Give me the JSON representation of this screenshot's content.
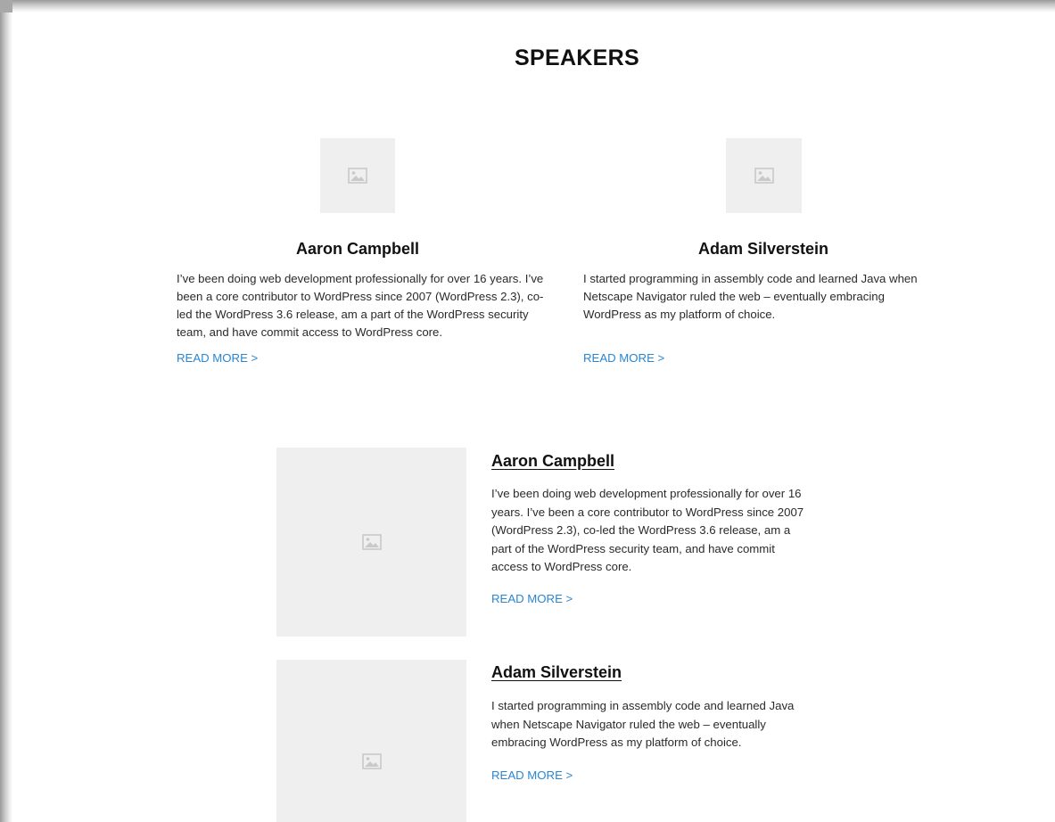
{
  "page": {
    "title": "SPEAKERS"
  },
  "grid": [
    {
      "name": "Aaron Campbell",
      "bio": "I’ve been doing web development professionally for over 16 years. I’ve been a core contributor to WordPress since 2007 (WordPress 2.3), co-led the WordPress 3.6 release, am a part of the WordPress security team, and have commit access to WordPress core.",
      "read_more": "READ MORE >"
    },
    {
      "name": "Adam Silverstein",
      "bio": "I started programming in assembly code and learned Java when Netscape Navigator ruled the web – eventually embracing WordPress as my platform of choice.",
      "read_more": "READ MORE >"
    }
  ],
  "list": [
    {
      "name": "Aaron Campbell",
      "bio": "I’ve been doing web development professionally for over 16 years. I’ve been a core contributor to WordPress since 2007 (WordPress 2.3), co-led the WordPress 3.6 release, am a part of the WordPress security team, and have commit access to WordPress core.",
      "read_more": "READ MORE >"
    },
    {
      "name": "Adam Silverstein",
      "bio": "I started programming in assembly code and learned Java when Netscape Navigator ruled the web – eventually embracing WordPress as my platform of choice.",
      "read_more": "READ MORE >"
    }
  ],
  "icons": {
    "placeholder": "image-placeholder-icon"
  },
  "colors": {
    "link": "#2a86d1",
    "placeholder_bg": "#efefef",
    "icon": "#c9c9c9"
  }
}
